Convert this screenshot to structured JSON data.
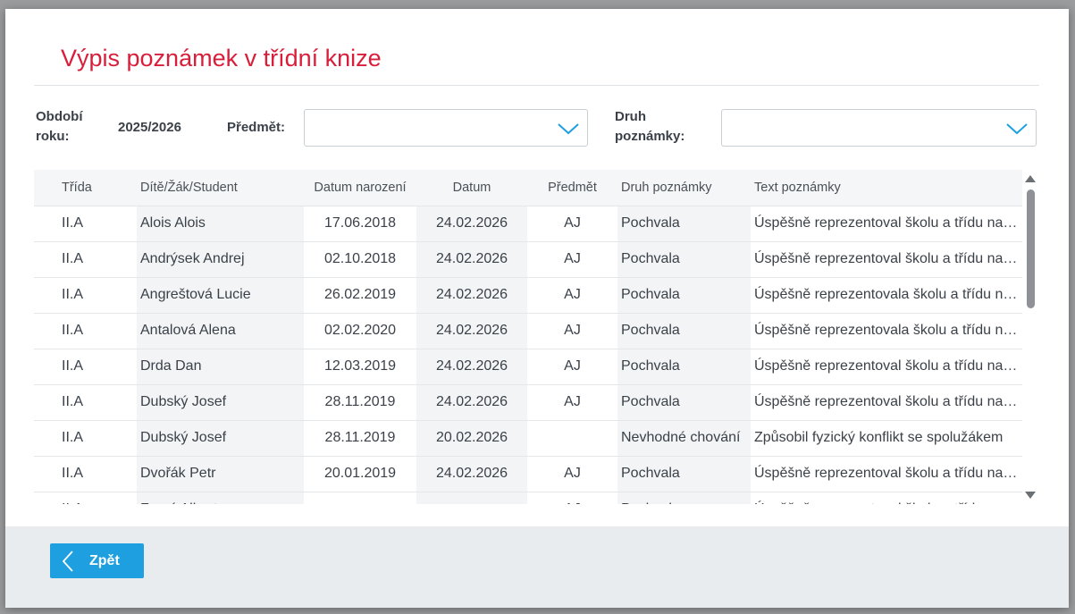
{
  "modal": {
    "title": "Výpis poznámek v třídní knize"
  },
  "filters": {
    "period_label_1": "Období",
    "period_label_2": "roku:",
    "period_value": "2025/2026",
    "subject_label": "Předmět:",
    "subject_value": "",
    "note_type_label_1": "Druh",
    "note_type_label_2": "poznámky:",
    "note_type_value": ""
  },
  "table": {
    "columns": [
      "Třída",
      "Dítě/Žák/Student",
      "Datum narození",
      "Datum",
      "Předmět",
      "Druh poznámky",
      "Text poznámky"
    ],
    "rows": [
      [
        "II.A",
        "Alois Alois",
        "17.06.2018",
        "24.02.2026",
        "AJ",
        "Pochvala",
        "Úspěšně reprezentoval školu a třídu na soutěži"
      ],
      [
        "II.A",
        "Andrýsek Andrej",
        "02.10.2018",
        "24.02.2026",
        "AJ",
        "Pochvala",
        "Úspěšně reprezentoval školu a třídu na soutěži"
      ],
      [
        "II.A",
        "Angreštová Lucie",
        "26.02.2019",
        "24.02.2026",
        "AJ",
        "Pochvala",
        "Úspěšně reprezentovala školu a třídu na soutěži"
      ],
      [
        "II.A",
        "Antalová Alena",
        "02.02.2020",
        "24.02.2026",
        "AJ",
        "Pochvala",
        "Úspěšně reprezentovala školu a třídu na soutěži"
      ],
      [
        "II.A",
        "Drda Dan",
        "12.03.2019",
        "24.02.2026",
        "AJ",
        "Pochvala",
        "Úspěšně reprezentoval školu a třídu na soutěži"
      ],
      [
        "II.A",
        "Dubský Josef",
        "28.11.2019",
        "24.02.2026",
        "AJ",
        "Pochvala",
        "Úspěšně reprezentoval školu a třídu na soutěži"
      ],
      [
        "II.A",
        "Dubský Josef",
        "28.11.2019",
        "20.02.2026",
        "",
        "Nevhodné chování",
        "Způsobil fyzický konflikt se spolužákem"
      ],
      [
        "II.A",
        "Dvořák Petr",
        "20.01.2019",
        "24.02.2026",
        "AJ",
        "Pochvala",
        "Úspěšně reprezentoval školu a třídu na soutěži"
      ],
      [
        "II.A",
        "Franý Albert",
        "",
        "",
        "AJ",
        "Pochvala",
        "Úspěšně reprezentoval školu a třídu na soutěži"
      ]
    ]
  },
  "footer": {
    "back_label": "Zpět"
  },
  "colors": {
    "title": "#d81e3a",
    "button": "#1ea0e0",
    "chevron": "#1ea0e0"
  }
}
